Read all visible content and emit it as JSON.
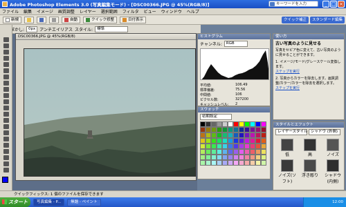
{
  "window": {
    "title": "Adobe Photoshop Elements 3.0 (写真編集モード) - [DSC00366.JPG @ 45%(RGB/8)]",
    "search_placeholder": "キーワードを入力",
    "min": "_",
    "max": "□",
    "close": "×"
  },
  "menu": [
    "ファイル",
    "編集",
    "イメージ",
    "画質調整",
    "レイヤー",
    "選択範囲",
    "フィルタ",
    "ビュー",
    "ウィンドウ",
    "ヘルプ"
  ],
  "toolbar": {
    "new": "新規",
    "auto": "自動",
    "quick_fix": "クイック修整",
    "date_view": "日付表示",
    "top_right": [
      "クイック補正",
      "スタンダード編集"
    ]
  },
  "options": {
    "feather_label": "ぼかし:",
    "feather_value": "0px",
    "antialias": "アンチエイリアス",
    "style_label": "スタイル:",
    "style_value": "標準"
  },
  "document": {
    "title": "DSC00366.JPG @ 45%(RGB/8)"
  },
  "panels": {
    "histogram": {
      "title": "ヒストグラム",
      "channel_label": "チャンネル:",
      "channel": "RGB",
      "stats": [
        [
          "平均値:",
          "106.49"
        ],
        [
          "標準偏差:",
          "75.56"
        ],
        [
          "中間値:",
          "106"
        ],
        [
          "ピクセル数:",
          "327200"
        ],
        [
          "レベル:",
          ""
        ],
        [
          "ピクセル数:",
          ""
        ],
        [
          "パーセンタイル:",
          ""
        ],
        [
          "キャッシュレベル:",
          "2"
        ]
      ]
    },
    "color_swatches": {
      "title": "スウォッチ",
      "set": "初期設定"
    },
    "guide": {
      "title": "使い方",
      "heading": "古い写真のように見せる",
      "intro": "写真をセピア色に変えて、古い写真のように見せることができます。",
      "steps": [
        "1. イメージ/モード/グレースケール変換します。",
        "2. 写真からカラーを除去します。画質調整/カラー/カラーを除去を選択します。"
      ],
      "link": "ステップを実行"
    },
    "effects": {
      "title": "スタイルとエフェクト",
      "layer_style": "レイヤースタイル",
      "shadow": "シャドウ (外側)",
      "items": [
        "低",
        "高",
        "ノイズ",
        "ノイズ(ソフト)",
        "浮き彫り",
        "シャドウ(内側)"
      ]
    }
  },
  "status": {
    "text": "クイックフィックス: 1 個のファイルを保存できます"
  },
  "taskbar": {
    "start": "スタート",
    "tasks": [
      "写真編集 - P...",
      "無題 - ペイント"
    ],
    "clock": "12:00"
  },
  "colors": {
    "titlebar": "#2f6fe0",
    "taskbar": "#2456c8",
    "start": "#3f9a32",
    "fg_swatch": "#0000ff"
  }
}
